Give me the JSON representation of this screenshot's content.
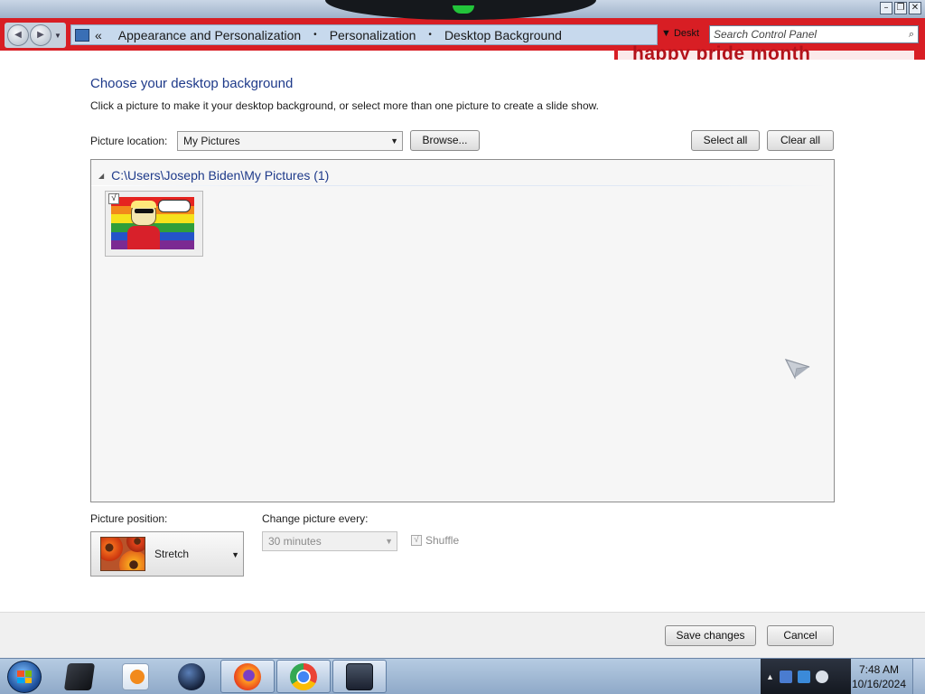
{
  "window": {
    "controls": {
      "minimize": "–",
      "maximize": "❐",
      "close": "✕"
    }
  },
  "address_bar": {
    "chevron": "«",
    "crumbs": [
      "Appearance and Personalization",
      "Personalization",
      "Desktop Background"
    ],
    "recent_label": "Deskt"
  },
  "search": {
    "placeholder": "Search Control Panel"
  },
  "banner_text": "happy pride month",
  "main": {
    "title": "Choose your desktop background",
    "description": "Click a picture to make it your desktop background, or select more than one picture to create a slide show.",
    "picture_location_label": "Picture location:",
    "picture_location_value": "My Pictures",
    "browse_label": "Browse...",
    "select_all_label": "Select all",
    "clear_all_label": "Clear all",
    "group_title": "C:\\Users\\Joseph Biden\\My Pictures (1)",
    "thumbnail_checked": "√",
    "picture_position_label": "Picture position:",
    "picture_position_value": "Stretch",
    "change_every_label": "Change picture every:",
    "change_every_value": "30 minutes",
    "shuffle_label": "Shuffle",
    "shuffle_check": "√"
  },
  "footer": {
    "save_label": "Save changes",
    "cancel_label": "Cancel"
  },
  "taskbar": {
    "items": [
      "terminal-icon",
      "media-player-icon",
      "network-globe-icon",
      "firefox-icon",
      "chrome-icon",
      "window-app-icon"
    ],
    "clock_time": "7:48 AM",
    "clock_date": "10/16/2024"
  },
  "colors": {
    "titlebar_red": "#d81e24",
    "heading_blue": "#1e3a8a"
  }
}
